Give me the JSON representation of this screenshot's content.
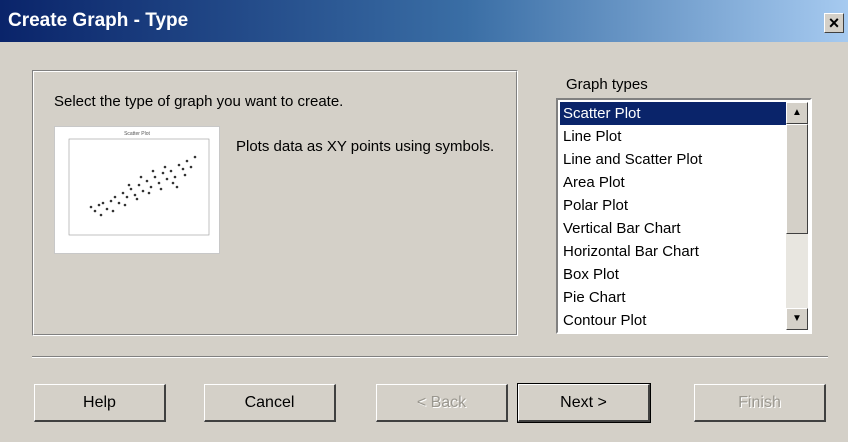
{
  "window": {
    "title": "Create Graph - Type",
    "close_glyph": "×"
  },
  "panel": {
    "prompt": "Select the type of graph you want to create.",
    "preview_title": "Scatter Plot",
    "description": "Plots data as XY points using symbols."
  },
  "graph_types": {
    "label": "Graph types",
    "selected_index": 0,
    "items": [
      "Scatter Plot",
      "Line Plot",
      "Line and Scatter Plot",
      "Area Plot",
      "Polar Plot",
      "Vertical Bar Chart",
      "Horizontal Bar Chart",
      "Box Plot",
      "Pie Chart",
      "Contour Plot"
    ]
  },
  "buttons": {
    "help": "Help",
    "cancel": "Cancel",
    "back": "< Back",
    "next": "Next >",
    "finish": "Finish"
  },
  "colors": {
    "selection": "#0a246a",
    "dialog_bg": "#d4d0c8"
  },
  "icons": {
    "scroll_up": "scroll-up-arrow-icon",
    "scroll_down": "scroll-down-arrow-icon"
  }
}
